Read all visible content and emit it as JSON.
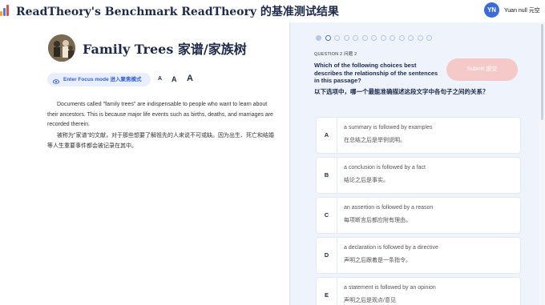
{
  "header": {
    "app_title": "ReadTheory's Benchmark  ReadTheory 的基准测试结果",
    "avatar_initials": "YN",
    "user_name": "Yuan null  元空"
  },
  "passage": {
    "title": "Family Trees  家谱/家族树",
    "focus_mode_label": "Enter Focus mode  进入聚焦模式",
    "font_sizes": [
      "A",
      "A",
      "A"
    ],
    "paragraph_en": "Documents called \"family trees\" are indispensable to people who want to learn about their ancestors. This is because major life events such as births, deaths, and marriages are recorded therein.",
    "paragraph_zh": "被称为\"家谱\"的文献，对于那些想要了解祖先的人来说不可或缺。因为出生、死亡和结婚等人生重要事件都会被记录在其中。"
  },
  "question": {
    "label": "QUESTION 2  问题 2",
    "text_en": "Which of the following choices best describes the relationship of the sentences in this passage?",
    "text_zh": "以下选项中，哪一个最能准确描述这段文字中各句子之间的关系？",
    "submit_label": "Submit  提交",
    "progress_total": 13,
    "progress_current": 2
  },
  "choices": [
    {
      "letter": "A",
      "en": "a summary is followed by examples",
      "zh": "在总结之后是举例说明。"
    },
    {
      "letter": "B",
      "en": "a conclusion is followed by a fact",
      "zh": "结论之后是事实。"
    },
    {
      "letter": "C",
      "en": "an assertion is followed by a reason",
      "zh": "每项断言后都应附有理由。"
    },
    {
      "letter": "D",
      "en": "a declaration is followed by a directive",
      "zh": "声明之后跟着是一条指令。"
    },
    {
      "letter": "E",
      "en": "a statement is followed by an opinion",
      "zh": "声明之后是观点/意见"
    }
  ],
  "colors": {
    "accent": "#3b6bd6",
    "submit_disabled": "#f6c9c9",
    "panel_bg": "#eef3fc"
  }
}
